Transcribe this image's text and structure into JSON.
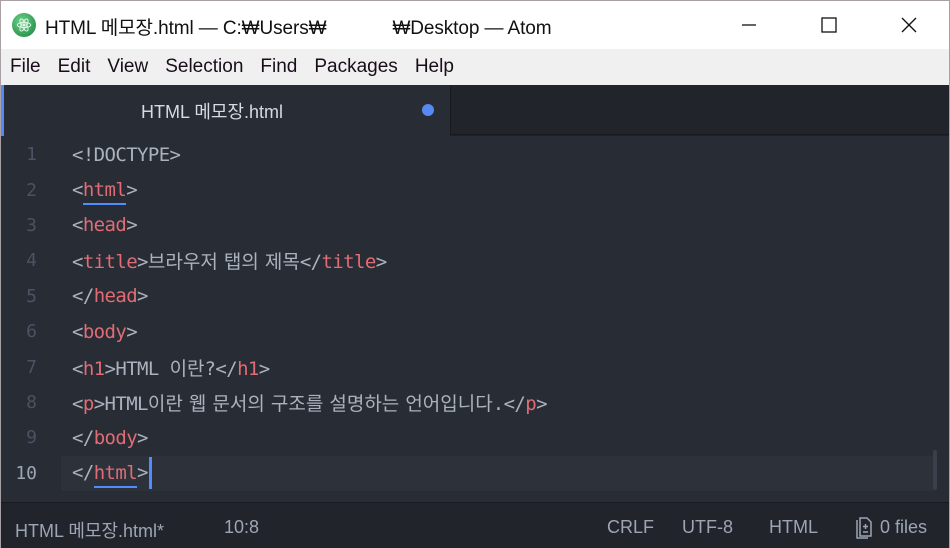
{
  "window": {
    "title_prefix": "HTML 메모장.html — C:₩Users₩",
    "title_suffix": "₩Desktop — Atom",
    "controls": {
      "minimize": "minimize-icon",
      "maximize": "maximize-icon",
      "close": "close-icon"
    }
  },
  "menu": {
    "items": [
      {
        "label": "File"
      },
      {
        "label": "Edit"
      },
      {
        "label": "View"
      },
      {
        "label": "Selection"
      },
      {
        "label": "Find"
      },
      {
        "label": "Packages"
      },
      {
        "label": "Help"
      }
    ]
  },
  "tabs": [
    {
      "label": "HTML 메모장.html",
      "modified": true,
      "active": true
    }
  ],
  "editor": {
    "lines": [
      {
        "num": "1",
        "parts": [
          {
            "t": "punc",
            "v": "<!DOCTYPE>"
          }
        ]
      },
      {
        "num": "2",
        "parts": [
          {
            "t": "punc",
            "v": "<"
          },
          {
            "t": "tag",
            "v": "html",
            "match": true
          },
          {
            "t": "punc",
            "v": ">"
          }
        ]
      },
      {
        "num": "3",
        "parts": [
          {
            "t": "punc",
            "v": "<"
          },
          {
            "t": "tag",
            "v": "head"
          },
          {
            "t": "punc",
            "v": ">"
          }
        ]
      },
      {
        "num": "4",
        "parts": [
          {
            "t": "punc",
            "v": "<"
          },
          {
            "t": "tag",
            "v": "title"
          },
          {
            "t": "punc",
            "v": ">"
          },
          {
            "t": "text",
            "v": "브라우저 탭의 제목"
          },
          {
            "t": "punc",
            "v": "</"
          },
          {
            "t": "tag",
            "v": "title"
          },
          {
            "t": "punc",
            "v": ">"
          }
        ]
      },
      {
        "num": "5",
        "parts": [
          {
            "t": "punc",
            "v": "</"
          },
          {
            "t": "tag",
            "v": "head"
          },
          {
            "t": "punc",
            "v": ">"
          }
        ]
      },
      {
        "num": "6",
        "parts": [
          {
            "t": "punc",
            "v": "<"
          },
          {
            "t": "tag",
            "v": "body"
          },
          {
            "t": "punc",
            "v": ">"
          }
        ]
      },
      {
        "num": "7",
        "parts": [
          {
            "t": "punc",
            "v": "<"
          },
          {
            "t": "tag",
            "v": "h1"
          },
          {
            "t": "punc",
            "v": ">HTML "
          },
          {
            "t": "text",
            "v": "이란"
          },
          {
            "t": "punc",
            "v": "?</"
          },
          {
            "t": "tag",
            "v": "h1"
          },
          {
            "t": "punc",
            "v": ">"
          }
        ]
      },
      {
        "num": "8",
        "parts": [
          {
            "t": "punc",
            "v": "<"
          },
          {
            "t": "tag",
            "v": "p"
          },
          {
            "t": "punc",
            "v": ">HTML"
          },
          {
            "t": "text",
            "v": "이란 웹 문서의 구조를 설명하는 언어입니다"
          },
          {
            "t": "punc",
            "v": ".</"
          },
          {
            "t": "tag",
            "v": "p"
          },
          {
            "t": "punc",
            "v": ">"
          }
        ]
      },
      {
        "num": "9",
        "parts": [
          {
            "t": "punc",
            "v": "</"
          },
          {
            "t": "tag",
            "v": "body"
          },
          {
            "t": "punc",
            "v": ">"
          }
        ]
      },
      {
        "num": "10",
        "parts": [
          {
            "t": "punc",
            "v": "</"
          },
          {
            "t": "tag",
            "v": "html",
            "match": true
          },
          {
            "t": "punc",
            "v": ">"
          }
        ],
        "cursor": true
      }
    ]
  },
  "status": {
    "file": "HTML 메모장.html*",
    "cursor": "10:8",
    "line_ending": "CRLF",
    "encoding": "UTF-8",
    "grammar": "HTML",
    "git": "0 files"
  },
  "colors": {
    "accent": "#568af2",
    "tag": "#e06c75",
    "text": "#abb2bf",
    "editor_bg": "#282c34",
    "status_bg": "#21252b"
  }
}
